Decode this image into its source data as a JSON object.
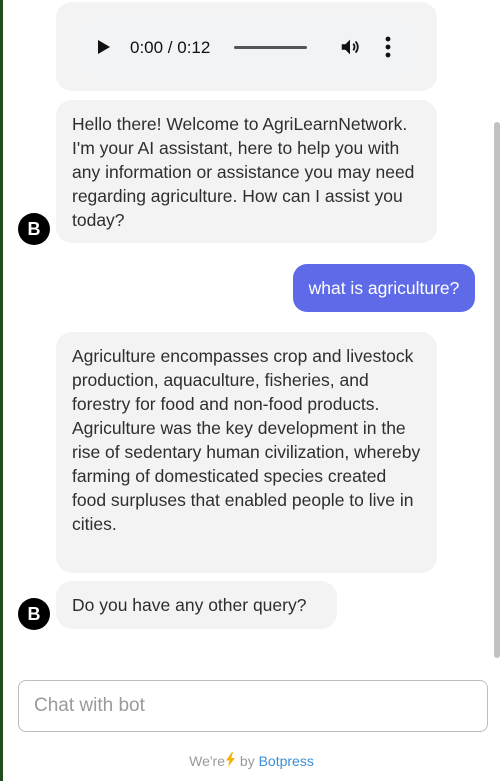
{
  "audio": {
    "time": "0:00 / 0:12",
    "progress": 0
  },
  "messages": [
    {
      "from": "bot",
      "text": "Hello there! Welcome to AgriLearnNetwork. I'm your AI assistant, here to help you with any information or assistance you may need regarding agriculture. How can I assist you today?"
    },
    {
      "from": "user",
      "text": "what is agriculture?"
    },
    {
      "from": "bot",
      "text": "Agriculture encompasses crop and livestock production, aquaculture, fisheries, and forestry for food and non-food products. Agriculture was the key development in the rise of sedentary human civilization, whereby farming of domesticated species created food surpluses that enabled people to live in cities."
    },
    {
      "from": "bot",
      "text": "Do you have any other query?"
    }
  ],
  "avatar": {
    "initial": "B"
  },
  "composer": {
    "placeholder": "Chat with bot",
    "value": ""
  },
  "footer": {
    "prefix": "We're",
    "suffix": "by",
    "link": "Botpress"
  },
  "colors": {
    "user_bubble": "#5e6ae8",
    "bot_bubble": "#f3f3f3",
    "link": "#3a8fd6",
    "bolt": "#f0b400"
  },
  "icons": {
    "play": "play-icon",
    "volume": "volume-icon",
    "more": "more-vertical-icon",
    "bolt": "lightning-icon"
  }
}
